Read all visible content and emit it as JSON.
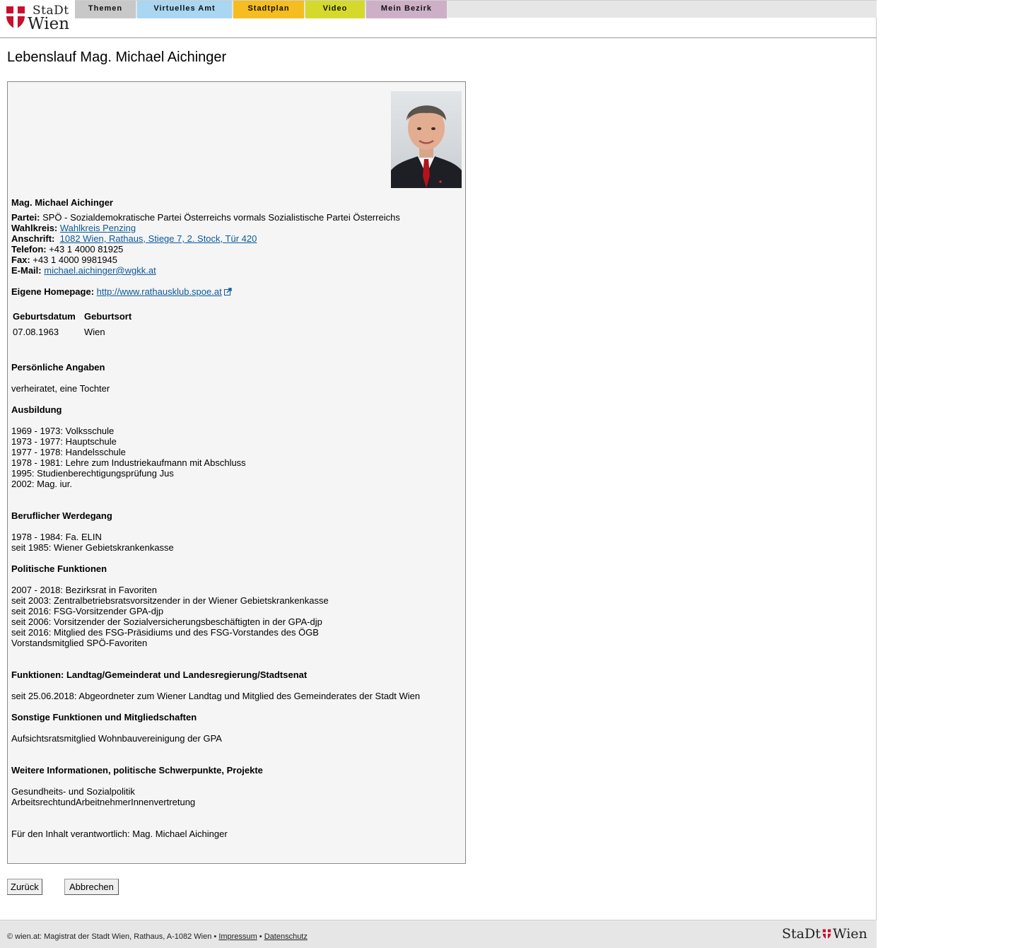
{
  "header": {
    "logo": {
      "line1": "StaDt",
      "line2": "Wien"
    },
    "nav": [
      {
        "label": "Themen",
        "color": "#c8c8c8"
      },
      {
        "label": "Virtuelles Amt",
        "color": "#a9d6f0"
      },
      {
        "label": "Stadtplan",
        "color": "#f5bd1f"
      },
      {
        "label": "Video",
        "color": "#d5d92b"
      },
      {
        "label": "Mein Bezirk",
        "color": "#cdb0c8"
      }
    ]
  },
  "page_title": "Lebenslauf Mag. Michael Aichinger",
  "person": {
    "name": "Mag. Michael Aichinger",
    "party_label": "Partei:",
    "party": "SPÖ - Sozialdemokratische Partei Österreichs vormals Sozialistische Partei Österreichs",
    "district_label": "Wahlkreis:",
    "district": "Wahlkreis Penzing",
    "address_label": "Anschrift:",
    "address": "1082 Wien, Rathaus, Stiege 7, 2. Stock, Tür 420",
    "phone_label": "Telefon:",
    "phone": "+43 1 4000 81925",
    "fax_label": "Fax:",
    "fax": "+43 1 4000 9981945",
    "email_label": "E-Mail:",
    "email": "michael.aichinger@wgkk.at",
    "homepage_label": "Eigene Homepage:",
    "homepage": "http://www.rathausklub.spoe.at",
    "birth_table": {
      "headers": [
        "Geburtsdatum",
        "Geburtsort"
      ],
      "row": [
        "07.08.1963",
        "Wien"
      ]
    }
  },
  "sections": {
    "personal": {
      "heading": "Persönliche Angaben",
      "lines": [
        "verheiratet, eine Tochter"
      ]
    },
    "education": {
      "heading": "Ausbildung",
      "lines": [
        "1969 - 1973: Volksschule",
        "1973 - 1977: Hauptschule",
        "1977 - 1978: Handelsschule",
        "1978 - 1981: Lehre zum Industriekaufmann mit Abschluss",
        "1995: Studienberechtigungsprüfung Jus",
        "2002: Mag. iur."
      ]
    },
    "career": {
      "heading": "Beruflicher Werdegang",
      "lines": [
        "1978 - 1984: Fa. ELIN",
        "seit 1985: Wiener Gebietskrankenkasse"
      ]
    },
    "political": {
      "heading": "Politische Funktionen",
      "lines": [
        "2007 - 2018: Bezirksrat in Favoriten",
        "seit 2003: Zentralbetriebsratsvorsitzender in der Wiener Gebietskrankenkasse",
        "seit 2016: FSG-Vorsitzender GPA-djp",
        "seit 2006: Vorsitzender der Sozialversicherungsbeschäftigten in der GPA-djp",
        "seit 2016: Mitglied des FSG-Präsidiums und des FSG-Vorstandes des ÖGB",
        "Vorstandsmitglied SPÖ-Favoriten"
      ]
    },
    "functions": {
      "heading": "Funktionen: Landtag/Gemeinderat und Landesregierung/Stadtsenat",
      "lines": [
        "seit 25.06.2018: Abgeordneter zum Wiener Landtag und Mitglied des Gemeinderates der Stadt Wien"
      ]
    },
    "other": {
      "heading": "Sonstige Funktionen und Mitgliedschaften",
      "lines": [
        "Aufsichtsratsmitglied Wohnbauvereinigung der GPA"
      ]
    },
    "further": {
      "heading": "Weitere Informationen, politische Schwerpunkte, Projekte",
      "lines": [
        "Gesundheits- und Sozialpolitik",
        "ArbeitsrechtundArbeitnehmerInnenvertretung"
      ]
    },
    "responsible": "Für den Inhalt verantwortlich: Mag. Michael Aichinger"
  },
  "buttons": {
    "back": "Zurück",
    "cancel": "Abbrechen"
  },
  "footer": {
    "copyright": "© wien.at: Magistrat der Stadt Wien, Rathaus, A-1082 Wien •",
    "sep": "•",
    "imprint": "Impressum",
    "privacy": "Datenschutz",
    "logo_left": "StaDt",
    "logo_right": "Wien"
  },
  "colors": {
    "link": "#0b5a9a",
    "panel_bg": "#f5f5f5",
    "wien_red": "#c8102e"
  },
  "icons": [
    "wien-shield-icon",
    "external-link-icon"
  ]
}
